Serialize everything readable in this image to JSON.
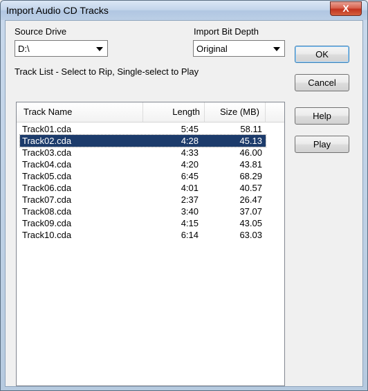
{
  "window": {
    "title": "Import Audio CD Tracks",
    "close_glyph": "X"
  },
  "source_drive": {
    "label": "Source Drive",
    "value": "D:\\"
  },
  "bit_depth": {
    "label": "Import Bit Depth",
    "value": "Original"
  },
  "track_list_label": "Track List - Select to Rip, Single-select to Play",
  "columns": {
    "name": "Track Name",
    "length": "Length",
    "size": "Size (MB)"
  },
  "tracks": [
    {
      "name": "Track01.cda",
      "length": "5:45",
      "size": "58.11",
      "selected": false
    },
    {
      "name": "Track02.cda",
      "length": "4:28",
      "size": "45.13",
      "selected": true
    },
    {
      "name": "Track03.cda",
      "length": "4:33",
      "size": "46.00",
      "selected": false
    },
    {
      "name": "Track04.cda",
      "length": "4:20",
      "size": "43.81",
      "selected": false
    },
    {
      "name": "Track05.cda",
      "length": "6:45",
      "size": "68.29",
      "selected": false
    },
    {
      "name": "Track06.cda",
      "length": "4:01",
      "size": "40.57",
      "selected": false
    },
    {
      "name": "Track07.cda",
      "length": "2:37",
      "size": "26.47",
      "selected": false
    },
    {
      "name": "Track08.cda",
      "length": "3:40",
      "size": "37.07",
      "selected": false
    },
    {
      "name": "Track09.cda",
      "length": "4:15",
      "size": "43.05",
      "selected": false
    },
    {
      "name": "Track10.cda",
      "length": "6:14",
      "size": "63.03",
      "selected": false
    }
  ],
  "buttons": {
    "ok": "OK",
    "cancel": "Cancel",
    "help": "Help",
    "play": "Play"
  },
  "colors": {
    "selection": "#1c3b6b",
    "titlebar": "#c2d4ea",
    "close": "#c2331f"
  }
}
